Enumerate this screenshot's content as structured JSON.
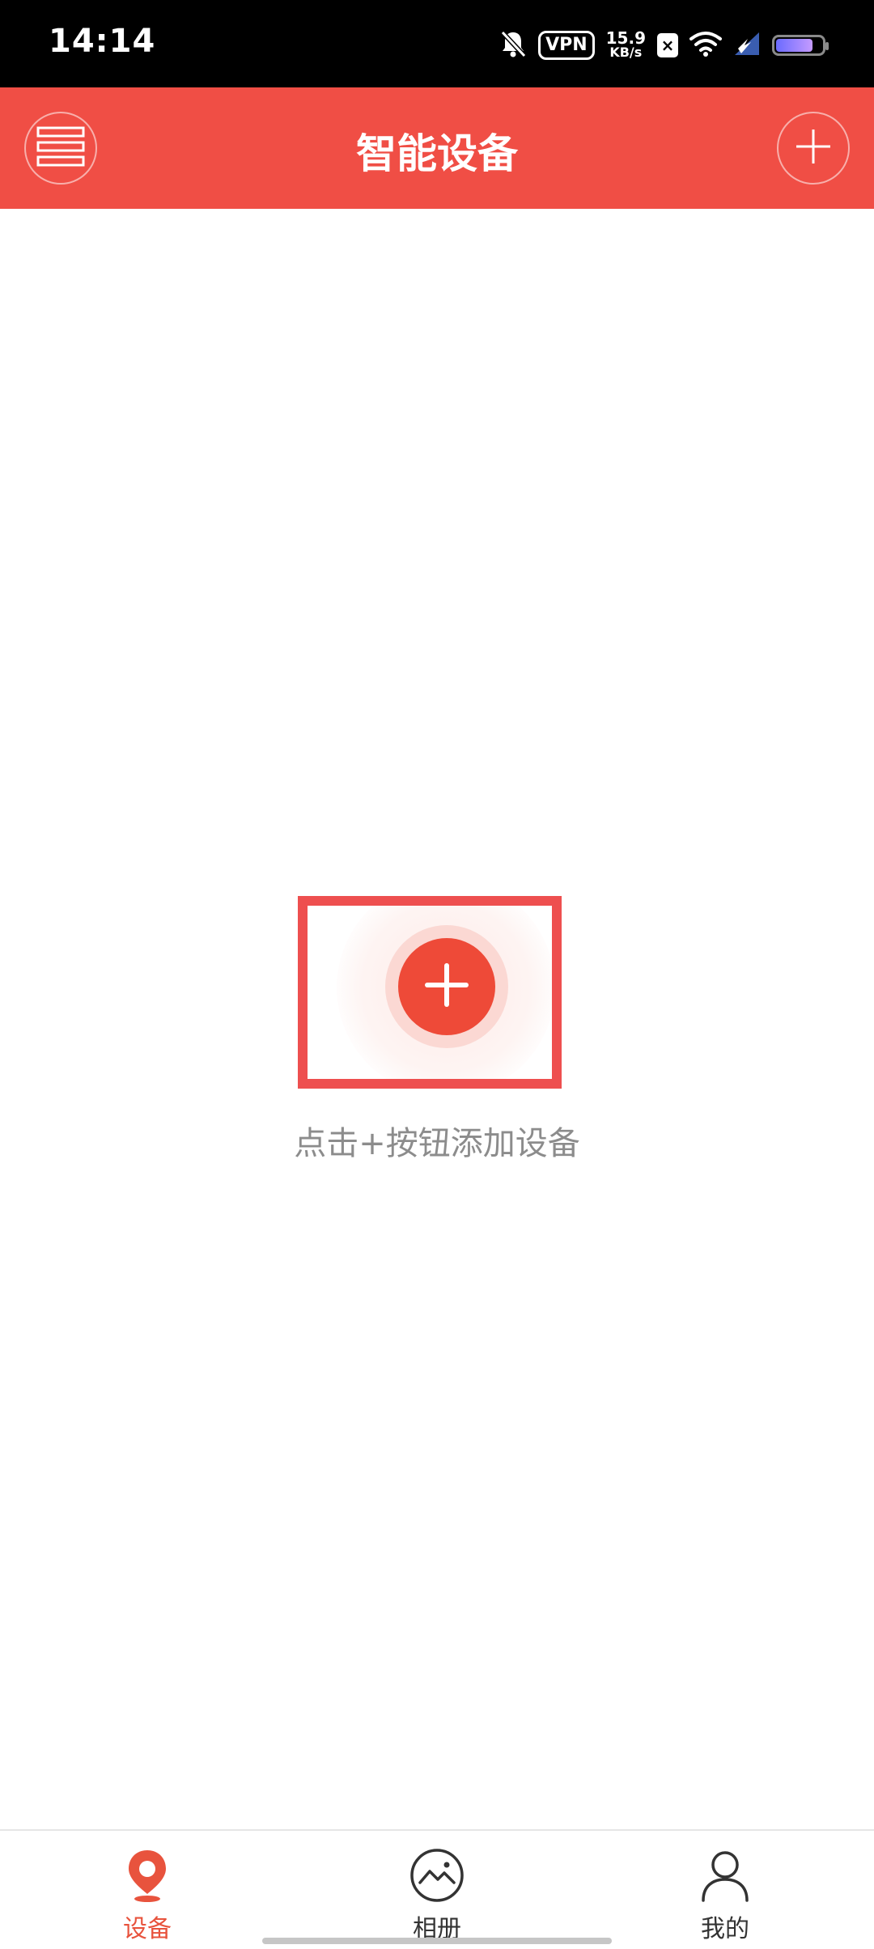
{
  "status_bar": {
    "time": "14:14",
    "vpn": "VPN",
    "speed_value": "15.9",
    "speed_unit": "KB/s",
    "x_badge": "×"
  },
  "header": {
    "title": "智能设备",
    "menu_icon": "menu-icon",
    "add_icon": "plus-icon",
    "bg_color": "#f04e45"
  },
  "empty_state": {
    "hint": "点击+按钮添加设备",
    "add_icon": "plus-icon",
    "button_color": "#ee4a38"
  },
  "bottom_nav": {
    "items": [
      {
        "label": "设备",
        "icon": "location-pin-icon",
        "active": true
      },
      {
        "label": "相册",
        "icon": "album-icon",
        "active": false
      },
      {
        "label": "我的",
        "icon": "person-icon",
        "active": false
      }
    ],
    "active_color": "#e8533d"
  }
}
